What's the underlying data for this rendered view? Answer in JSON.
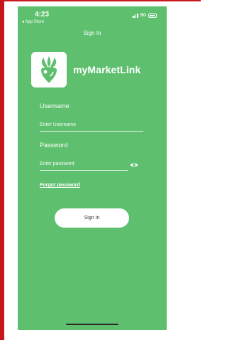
{
  "status_bar": {
    "time": "4:23",
    "back_app": "◂ App Store",
    "network": "5G"
  },
  "nav": {
    "title": "Sign In"
  },
  "brand": {
    "name": "myMarketLink"
  },
  "form": {
    "username_label": "Username",
    "username_placeholder": "Enter Username",
    "password_label": "Password",
    "password_placeholder": "Enter password",
    "forgot_label": "Forgot password",
    "submit_label": "Sign In"
  },
  "colors": {
    "background": "#5ec06e",
    "accent": "#ffffff",
    "frame_red": "#c8171c"
  },
  "icons": [
    "signal-icon",
    "battery-icon",
    "radish-logo-icon",
    "eye-icon"
  ]
}
